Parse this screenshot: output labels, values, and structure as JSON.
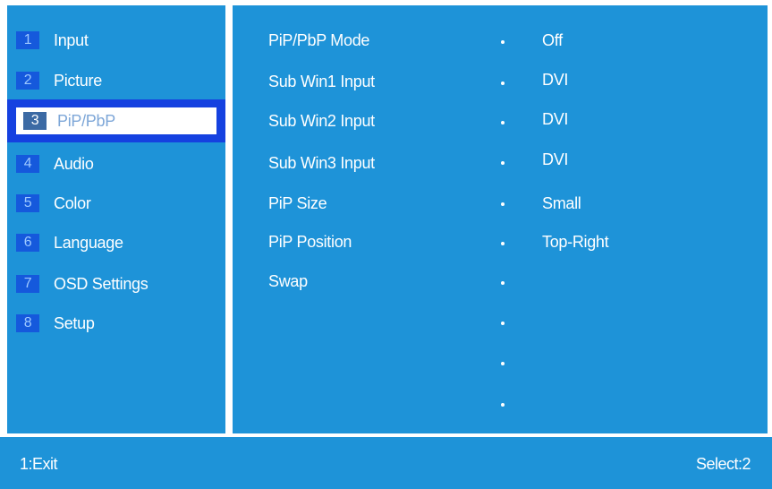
{
  "menu": {
    "items": [
      {
        "num": "1",
        "label": "Input"
      },
      {
        "num": "2",
        "label": "Picture"
      },
      {
        "num": "3",
        "label": "PiP/PbP",
        "selected": true
      },
      {
        "num": "4",
        "label": "Audio"
      },
      {
        "num": "5",
        "label": "Color"
      },
      {
        "num": "6",
        "label": "Language"
      },
      {
        "num": "7",
        "label": "OSD Settings"
      },
      {
        "num": "8",
        "label": "Setup"
      }
    ]
  },
  "options": [
    {
      "label": "PiP/PbP Mode",
      "value": "Off"
    },
    {
      "label": "Sub Win1 Input",
      "value": "DVI"
    },
    {
      "label": "Sub Win2 Input",
      "value": "DVI"
    },
    {
      "label": "Sub Win3 Input",
      "value": "DVI"
    },
    {
      "label": "PiP Size",
      "value": "Small"
    },
    {
      "label": "PiP Position",
      "value": "Top-Right"
    },
    {
      "label": "Swap",
      "value": ""
    },
    {
      "label": "",
      "value": ""
    },
    {
      "label": "",
      "value": ""
    },
    {
      "label": "",
      "value": ""
    }
  ],
  "footer": {
    "left": "1:Exit",
    "right": "Select:2"
  },
  "colors": {
    "panel": "#1e93d8",
    "badge": "#1559dc",
    "selection_bar": "#1541e0"
  }
}
